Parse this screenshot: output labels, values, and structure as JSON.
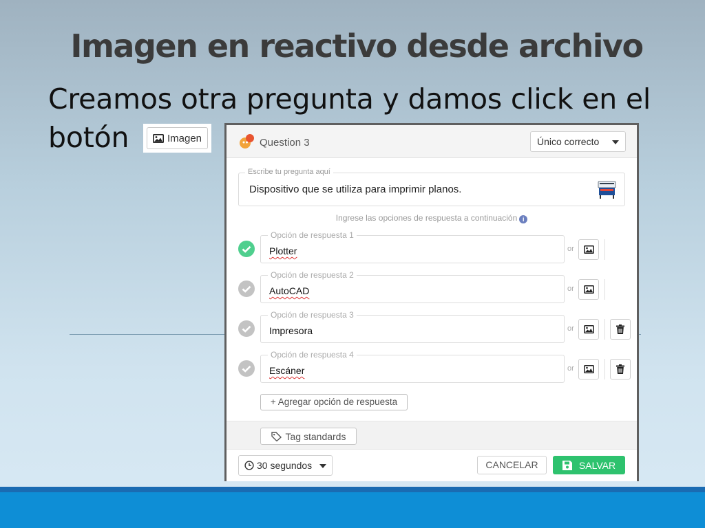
{
  "slide": {
    "title": "Imagen en reactivo desde archivo",
    "body_line1": "Creamos otra pregunta y damos click en el",
    "body_line2": "botón",
    "inline_button_label": "Imagen"
  },
  "editor": {
    "question_label": "Question 3",
    "answer_type": "Único correcto",
    "question_placeholder": "Escribe tu pregunta aquí",
    "question_text": "Dispositivo que se utiliza para imprimir planos.",
    "hint": "Ingrese las opciones de respuesta a continuación",
    "or_label": "or",
    "options": [
      {
        "legend": "Opción de respuesta 1",
        "value": "Plotter",
        "correct": true,
        "deletable": false
      },
      {
        "legend": "Opción de respuesta 2",
        "value": "AutoCAD",
        "correct": false,
        "deletable": false
      },
      {
        "legend": "Opción de respuesta 3",
        "value": "Impresora",
        "correct": false,
        "deletable": true
      },
      {
        "legend": "Opción de respuesta 4",
        "value": "Escáner",
        "correct": false,
        "deletable": true
      }
    ],
    "add_option_label": "+ Agregar opción de respuesta",
    "tag_label": "Tag standards",
    "time_label": "30 segundos",
    "cancel_label": "CANCELAR",
    "save_label": "SALVAR"
  },
  "colors": {
    "correct_check": "#4fcf8e",
    "inactive_check": "#c3c3c3",
    "save_button": "#2ec26e",
    "footer_band": "#0e8ed6"
  },
  "icons": {
    "logo": "quiz-logo-icon",
    "question_thumbnail": "plotter-image",
    "image_button": "image-icon",
    "delete_button": "trash-icon",
    "info": "info-icon",
    "tag": "tag-icon",
    "clock": "clock-icon",
    "save": "floppy-disk-icon"
  }
}
